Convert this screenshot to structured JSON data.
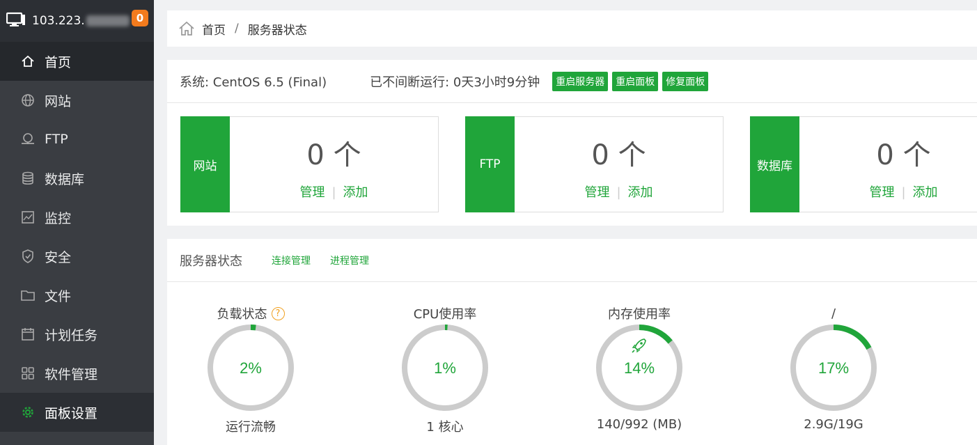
{
  "header": {
    "ip": "103.223.",
    "badge": "0"
  },
  "sidebar": {
    "items": [
      {
        "label": "首页",
        "icon": "home-icon"
      },
      {
        "label": "网站",
        "icon": "globe-icon"
      },
      {
        "label": "FTP",
        "icon": "ftp-icon"
      },
      {
        "label": "数据库",
        "icon": "database-icon"
      },
      {
        "label": "监控",
        "icon": "monitor-icon"
      },
      {
        "label": "安全",
        "icon": "shield-icon"
      },
      {
        "label": "文件",
        "icon": "folder-icon"
      },
      {
        "label": "计划任务",
        "icon": "calendar-icon"
      },
      {
        "label": "软件管理",
        "icon": "grid-icon"
      },
      {
        "label": "面板设置",
        "icon": "gear-icon"
      }
    ]
  },
  "breadcrumb": {
    "home": "首页",
    "sep": "/",
    "current": "服务器状态"
  },
  "system": {
    "os": "系统: CentOS 6.5 (Final)",
    "uptime": "已不间断运行: 0天3小时9分钟",
    "buttons": [
      "重启服务器",
      "重启面板",
      "修复面板"
    ]
  },
  "cards": [
    {
      "tag": "网站",
      "count": "0 个",
      "manage": "管理",
      "add": "添加"
    },
    {
      "tag": "FTP",
      "count": "0 个",
      "manage": "管理",
      "add": "添加"
    },
    {
      "tag": "数据库",
      "count": "0 个",
      "manage": "管理",
      "add": "添加"
    }
  ],
  "status": {
    "title": "服务器状态",
    "links": [
      "连接管理",
      "进程管理"
    ],
    "help": "?",
    "gauges": [
      {
        "title": "负载状态",
        "value": "2%",
        "sub": "运行流畅",
        "fraction": 0.02
      },
      {
        "title": "CPU使用率",
        "value": "1%",
        "sub": "1 核心",
        "fraction": 0.01
      },
      {
        "title": "内存使用率",
        "value": "14%",
        "sub": "140/992 (MB)",
        "fraction": 0.14
      },
      {
        "title": "/",
        "value": "17%",
        "sub": "2.9G/19G",
        "fraction": 0.17
      }
    ]
  },
  "colors": {
    "accent": "#20a53a",
    "sidebar": "#3a3d42",
    "badge": "#f37b1d",
    "ring": "#cccccc"
  }
}
